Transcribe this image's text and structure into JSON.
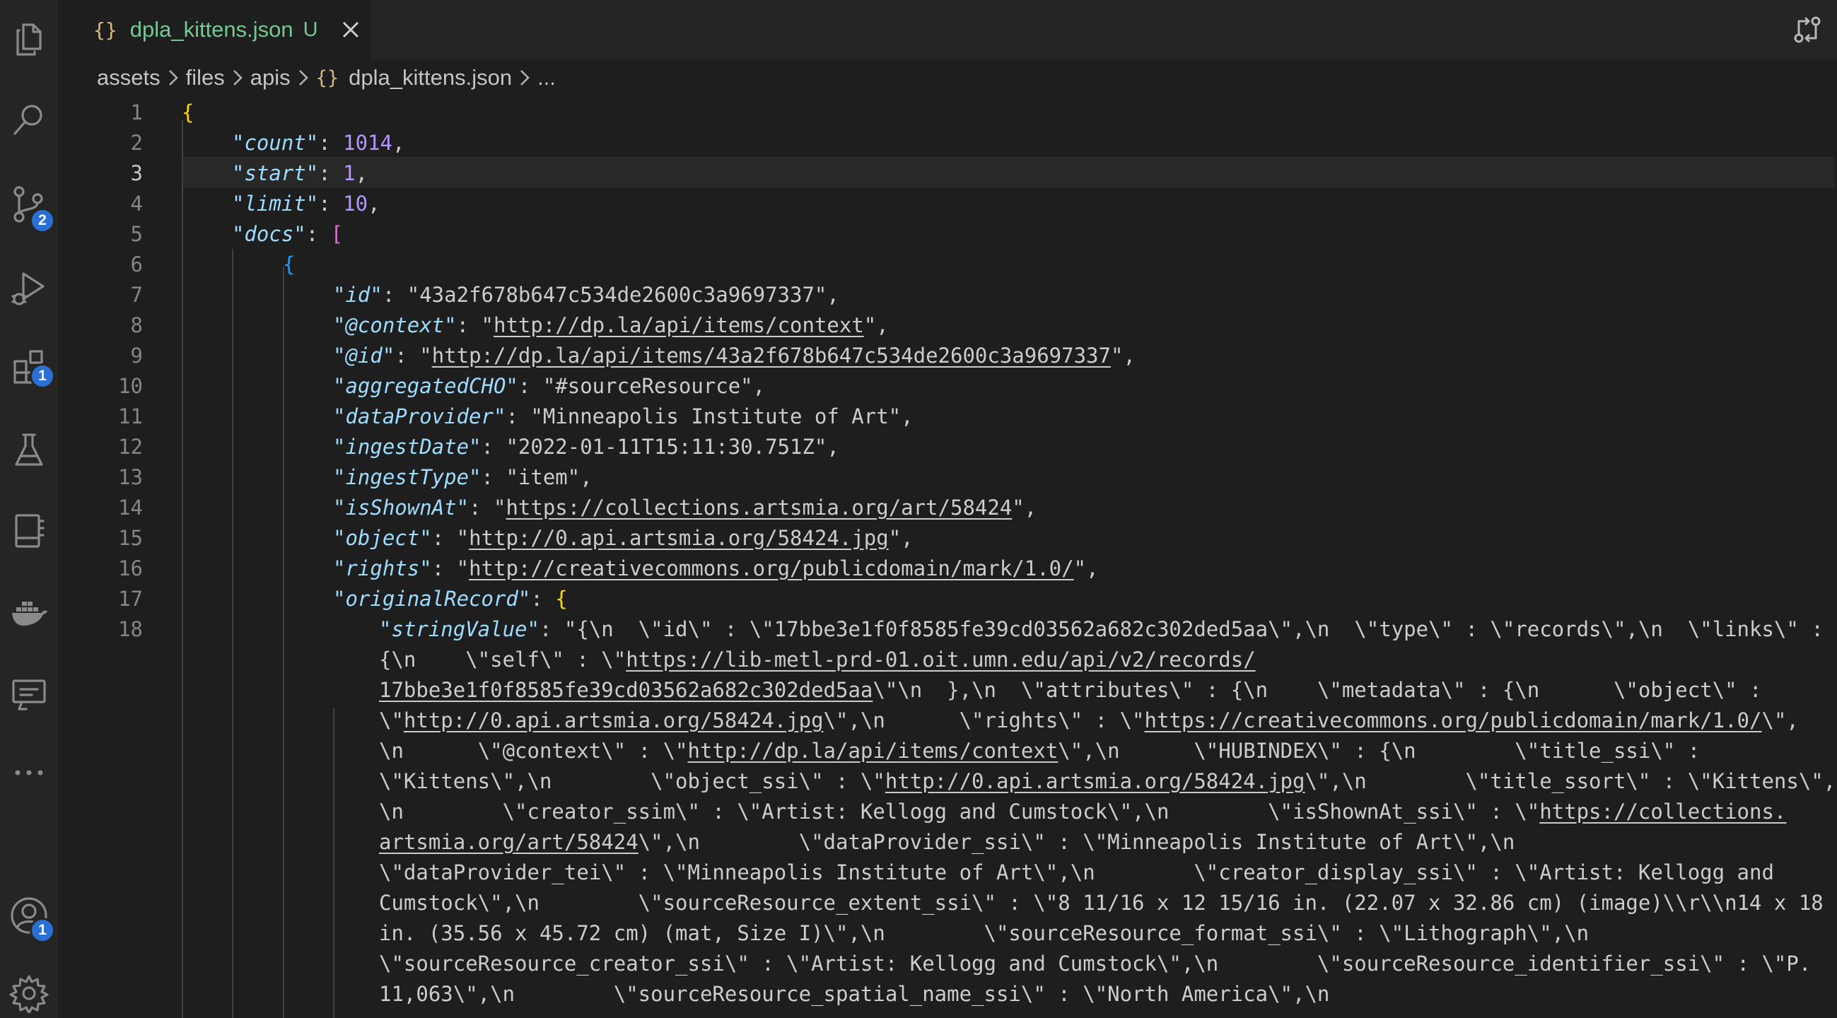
{
  "tab": {
    "filename": "dpla_kittens.json",
    "status": "U",
    "icon": "json-braces-icon"
  },
  "breadcrumb": {
    "items": [
      "assets",
      "files",
      "apis"
    ],
    "file": "dpla_kittens.json",
    "more": "..."
  },
  "activity_bar": {
    "items": [
      {
        "name": "explorer-icon"
      },
      {
        "name": "search-icon"
      },
      {
        "name": "source-control-icon",
        "badge": "2"
      },
      {
        "name": "run-debug-icon"
      },
      {
        "name": "extensions-icon",
        "badge": "1"
      },
      {
        "name": "testing-icon"
      },
      {
        "name": "notebook-icon"
      },
      {
        "name": "docker-icon"
      },
      {
        "name": "remote-explorer-icon"
      },
      {
        "name": "more-icon"
      }
    ],
    "bottom": [
      {
        "name": "accounts-icon",
        "badge": "1"
      },
      {
        "name": "settings-gear-icon"
      }
    ]
  },
  "editor": {
    "active_line": 3,
    "line_numbers": [
      "1",
      "2",
      "3",
      "4",
      "5",
      "6",
      "7",
      "8",
      "9",
      "10",
      "11",
      "12",
      "13",
      "14",
      "15",
      "16",
      "17",
      "18"
    ],
    "lines": {
      "l1": {
        "open": "{"
      },
      "l2": {
        "key": "\"count\"",
        "sep": ": ",
        "value": "1014",
        "end": ","
      },
      "l3": {
        "key": "\"start\"",
        "sep": ": ",
        "value": "1",
        "end": ","
      },
      "l4": {
        "key": "\"limit\"",
        "sep": ": ",
        "value": "10",
        "end": ","
      },
      "l5": {
        "key": "\"docs\"",
        "sep": ": ",
        "open": "["
      },
      "l6": {
        "open": "{"
      },
      "l7": {
        "key": "\"id\"",
        "sep": ": ",
        "value": "\"43a2f678b647c534de2600c3a9697337\"",
        "end": ","
      },
      "l8": {
        "key": "\"@context\"",
        "sep": ": ",
        "q1": "\"",
        "url": "http://dp.la/api/items/context",
        "q2": "\"",
        "end": ","
      },
      "l9": {
        "key": "\"@id\"",
        "sep": ": ",
        "q1": "\"",
        "url": "http://dp.la/api/items/43a2f678b647c534de2600c3a9697337",
        "q2": "\"",
        "end": ","
      },
      "l10": {
        "key": "\"aggregatedCHO\"",
        "sep": ": ",
        "value": "\"#sourceResource\"",
        "end": ","
      },
      "l11": {
        "key": "\"dataProvider\"",
        "sep": ": ",
        "value": "\"Minneapolis Institute of Art\"",
        "end": ","
      },
      "l12": {
        "key": "\"ingestDate\"",
        "sep": ": ",
        "value": "\"2022-01-11T15:11:30.751Z\"",
        "end": ","
      },
      "l13": {
        "key": "\"ingestType\"",
        "sep": ": ",
        "value": "\"item\"",
        "end": ","
      },
      "l14": {
        "key": "\"isShownAt\"",
        "sep": ": ",
        "q1": "\"",
        "url": "https://collections.artsmia.org/art/58424",
        "q2": "\"",
        "end": ","
      },
      "l15": {
        "key": "\"object\"",
        "sep": ": ",
        "q1": "\"",
        "url": "http://0.api.artsmia.org/58424.jpg",
        "q2": "\"",
        "end": ","
      },
      "l16": {
        "key": "\"rights\"",
        "sep": ": ",
        "q1": "\"",
        "url": "http://creativecommons.org/publicdomain/mark/1.0/",
        "q2": "\"",
        "end": ","
      },
      "l17": {
        "key": "\"originalRecord\"",
        "sep": ": ",
        "open": "{"
      },
      "l18": {
        "key": "\"stringValue\"",
        "sep": ": ",
        "w1": "\"{\\n  \\\"id\\\" : \\\"17bbe3e1f0f8585fe39cd03562a682c302ded5aa\\\",\\n  \\\"type\\\" : \\\"records\\\",\\n  \\\"links\\\" :",
        "w2a": "{\\n    \\\"self\\\" : \\\"",
        "w2u": "https://lib-metl-prd-01.oit.umn.edu/api/v2/records/",
        "w3u": "17bbe3e1f0f8585fe39cd03562a682c302ded5aa",
        "w3b": "\\\"\\n  },\\n  \\\"attributes\\\" : {\\n    \\\"metadata\\\" : {\\n      \\\"object\\\" :",
        "w4a": "\\\"",
        "w4u": "http://0.api.artsmia.org/58424.jpg",
        "w4b": "\\\",\\n      \\\"rights\\\" : \\\"",
        "w4u2": "https://creativecommons.org/publicdomain/mark/1.0/",
        "w4c": "\\\",",
        "w5a": "\\n      \\\"@context\\\" : \\\"",
        "w5u": "http://dp.la/api/items/context",
        "w5b": "\\\",\\n      \\\"HUBINDEX\\\" : {\\n        \\\"title_ssi\\\" :",
        "w6a": "\\\"Kittens\\\",\\n        \\\"object_ssi\\\" : \\\"",
        "w6u": "http://0.api.artsmia.org/58424.jpg",
        "w6b": "\\\",\\n        \\\"title_ssort\\\" : \\\"Kittens\\\",",
        "w7a": "\\n        \\\"creator_ssim\\\" : \\\"Artist: Kellogg and Cumstock\\\",\\n        \\\"isShownAt_ssi\\\" : \\\"",
        "w7u": "https://collections.",
        "w8u": "artsmia.org/art/58424",
        "w8b": "\\\",\\n        \\\"dataProvider_ssi\\\" : \\\"Minneapolis Institute of Art\\\",\\n",
        "w9": "\\\"dataProvider_tei\\\" : \\\"Minneapolis Institute of Art\\\",\\n        \\\"creator_display_ssi\\\" : \\\"Artist: Kellogg and",
        "w10": "Cumstock\\\",\\n        \\\"sourceResource_extent_ssi\\\" : \\\"8 11/16 x 12 15/16 in. (22.07 x 32.86 cm) (image)\\\\r\\\\n14 x 18",
        "w11": "in. (35.56 x 45.72 cm) (mat, Size I)\\\",\\n        \\\"sourceResource_format_ssi\\\" : \\\"Lithograph\\\",\\n",
        "w12": "\\\"sourceResource_creator_ssi\\\" : \\\"Artist: Kellogg and Cumstock\\\",\\n        \\\"sourceResource_identifier_ssi\\\" : \\\"P.",
        "w13": "11,063\\\",\\n        \\\"sourceResource_spatial_name_ssi\\\" : \\\"North America\\\",\\n"
      }
    }
  }
}
